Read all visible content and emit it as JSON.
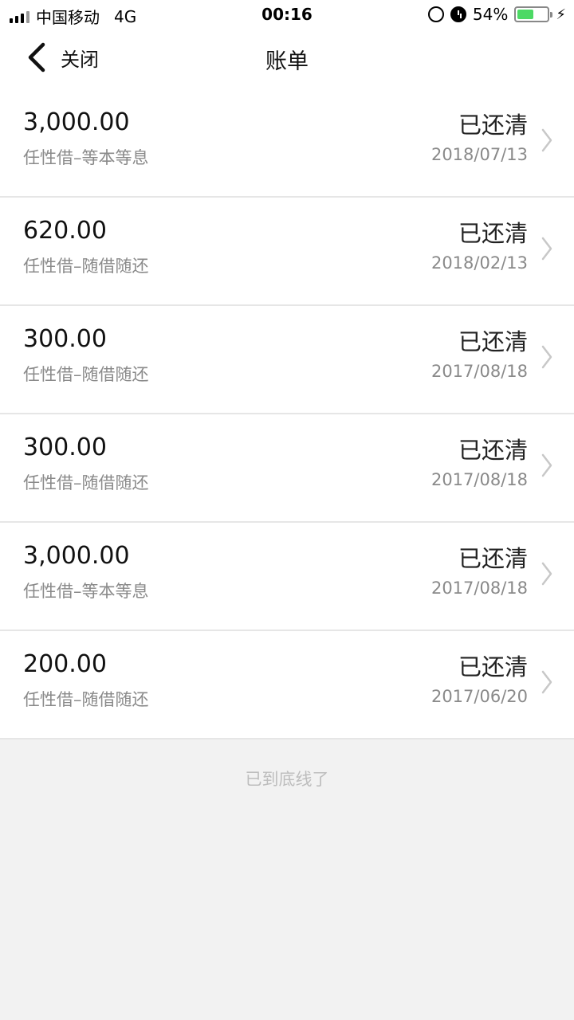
{
  "status": {
    "carrier": "中国移动",
    "network": "4G",
    "time": "00:16",
    "battery": "54%",
    "battery_level": 0.54,
    "battery_color": "#4cd964"
  },
  "nav": {
    "back_label": "关闭",
    "title": "账单"
  },
  "bills": [
    {
      "amount": "3,000.00",
      "product": "任性借–等本等息",
      "state": "已还清",
      "date": "2018/07/13"
    },
    {
      "amount": "620.00",
      "product": "任性借–随借随还",
      "state": "已还清",
      "date": "2018/02/13"
    },
    {
      "amount": "300.00",
      "product": "任性借–随借随还",
      "state": "已还清",
      "date": "2017/08/18"
    },
    {
      "amount": "300.00",
      "product": "任性借–随借随还",
      "state": "已还清",
      "date": "2017/08/18"
    },
    {
      "amount": "3,000.00",
      "product": "任性借–等本等息",
      "state": "已还清",
      "date": "2017/08/18"
    },
    {
      "amount": "200.00",
      "product": "任性借–随借随还",
      "state": "已还清",
      "date": "2017/06/20"
    }
  ],
  "footer": {
    "end_tip": "已到底线了"
  }
}
